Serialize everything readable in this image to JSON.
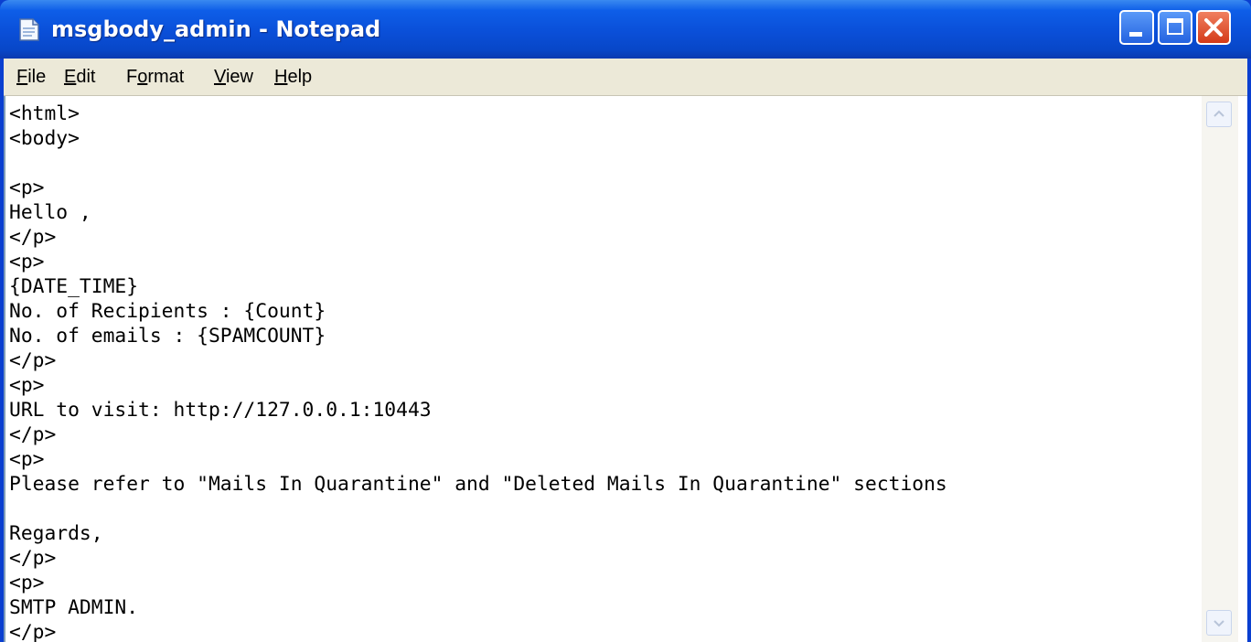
{
  "window": {
    "title": "msgbody_admin - Notepad"
  },
  "menu": {
    "file": {
      "accel": "F",
      "rest": "ile"
    },
    "edit": {
      "accel": "E",
      "rest": "dit"
    },
    "format": {
      "pre": "F",
      "accel": "o",
      "rest": "rmat"
    },
    "view": {
      "accel": "V",
      "rest": "iew"
    },
    "help": {
      "accel": "H",
      "rest": "elp"
    }
  },
  "document": {
    "content": "<html>\n<body>\n\n<p>\nHello ,\n</p>\n<p>\n{DATE_TIME}\nNo. of Recipients : {Count}\nNo. of emails : {SPAMCOUNT}\n</p>\n<p>\nURL to visit: http://127.0.0.1:10443\n</p>\n<p>\nPlease refer to \"Mails In Quarantine\" and \"Deleted Mails In Quarantine\" sections\n\nRegards,\n</p>\n<p>\nSMTP ADMIN.\n</p>"
  },
  "icons": {
    "app": "notepad-icon",
    "minimize": "minimize-icon",
    "maximize": "maximize-icon",
    "close": "close-icon",
    "scroll_up": "chevron-up-icon",
    "scroll_down": "chevron-down-icon"
  },
  "colors": {
    "titlebar": "#0a4fd8",
    "close_button": "#d43a18",
    "menubar": "#ece9d8"
  }
}
